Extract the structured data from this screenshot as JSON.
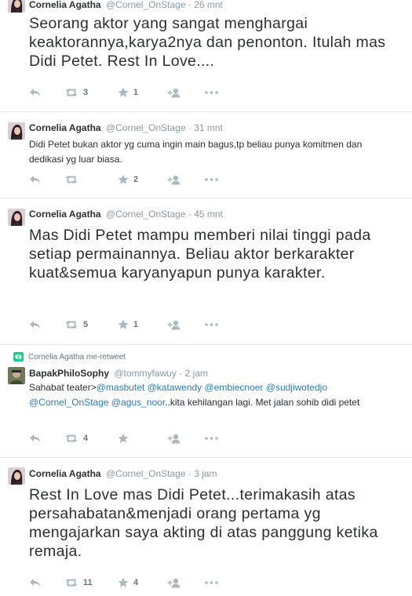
{
  "tweets": [
    {
      "name": "Cornelia Agatha",
      "handle": "@Cornel_OnStage",
      "dot": "·",
      "time": "26 mnt",
      "text": "Seorang aktor yang sangat menghargai keaktorannya,karya2nya dan penonton. Itulah mas Didi Petet. Rest In Love....",
      "retweets": "3",
      "favorites": "1"
    },
    {
      "name": "Cornelia Agatha",
      "handle": "@Cornel_OnStage",
      "dot": "·",
      "time": "31 mnt",
      "text": "Didi Petet bukan aktor yg cuma ingin main bagus,tp beliau punya komitmen dan dedikasi yg luar biasa.",
      "retweets": "",
      "favorites": "2"
    },
    {
      "name": "Cornelia Agatha",
      "handle": "@Cornel_OnStage",
      "dot": "·",
      "time": "45 mnt",
      "text": "Mas Didi Petet mampu memberi nilai tinggi pada setiap permainannya. Beliau aktor berkarakter kuat&semua karyanyapun punya karakter.",
      "retweets": "5",
      "favorites": "1"
    },
    {
      "retweet_context": "Cornelia Agatha me-retweet",
      "name": "BapakPhiloSophy",
      "handle": "@tommyfawuy",
      "dot": "·",
      "time": "2 jam",
      "text_parts": [
        {
          "t": "Sahabat teater>",
          "m": false
        },
        {
          "t": "@masbutet",
          "m": true
        },
        {
          "t": " ",
          "m": false
        },
        {
          "t": "@katawendy",
          "m": true
        },
        {
          "t": " ",
          "m": false
        },
        {
          "t": "@embiecnoer",
          "m": true
        },
        {
          "t": " ",
          "m": false
        },
        {
          "t": "@sudjiwotedjo",
          "m": true
        },
        {
          "t": " ",
          "m": false
        },
        {
          "t": "@Cornel_OnStage",
          "m": true
        },
        {
          "t": " ",
          "m": false
        },
        {
          "t": "@agus_noor",
          "m": true
        },
        {
          "t": "..kita kehilangan lagi. Met jalan sohib didi petet",
          "m": false
        }
      ],
      "retweets": "4",
      "favorites": ""
    },
    {
      "name": "Cornelia Agatha",
      "handle": "@Cornel_OnStage",
      "dot": "·",
      "time": "3 jam",
      "text": "Rest In Love mas Didi Petet...terimakasih atas persahabatan&menjadi orang pertama yg mengajarkan saya akting di atas panggung ketika remaja.",
      "retweets": "11",
      "favorites": "4"
    }
  ],
  "icons": {
    "reply": "reply-icon",
    "retweet": "retweet-icon",
    "favorite": "star-icon",
    "follow": "follow-icon",
    "more": "more-icon"
  },
  "colors": {
    "name": "#292f33",
    "meta": "#8899a6",
    "mention": "#2b7bb9",
    "icon": "#aab8c2",
    "retweet_badge": "#19cf86",
    "divider": "#e1e8ed"
  }
}
